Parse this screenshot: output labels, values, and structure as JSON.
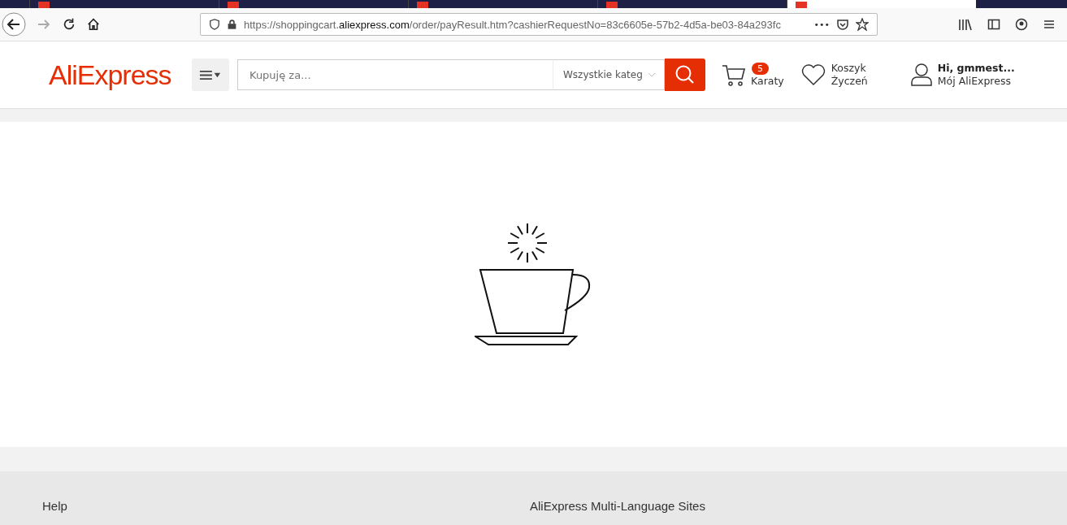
{
  "browser": {
    "tabs": [
      {
        "selected": false
      },
      {
        "selected": false
      },
      {
        "selected": false
      },
      {
        "selected": false
      },
      {
        "selected": true
      }
    ],
    "url": {
      "prefix": "https://shoppingcart.",
      "domain": "aliexpress.com",
      "path": "/order/payResult.htm?cashierRequestNo=83c6605e-57b2-4d5a-be03-84a293fc"
    },
    "url_more": "•••"
  },
  "header": {
    "logo": "AliExpress",
    "search": {
      "placeholder": "Kupuję za...",
      "category": "Wszystkie kateg"
    },
    "cart": {
      "count": "5",
      "label": "Karaty"
    },
    "wishlist": {
      "line1": "Koszyk",
      "line2": "Życzeń"
    },
    "account": {
      "greeting": "Hi, gmmest...",
      "link": "Mój AliExpress"
    }
  },
  "footer": {
    "columns": [
      "Help",
      "AliExpress Multi-Language Sites"
    ]
  }
}
